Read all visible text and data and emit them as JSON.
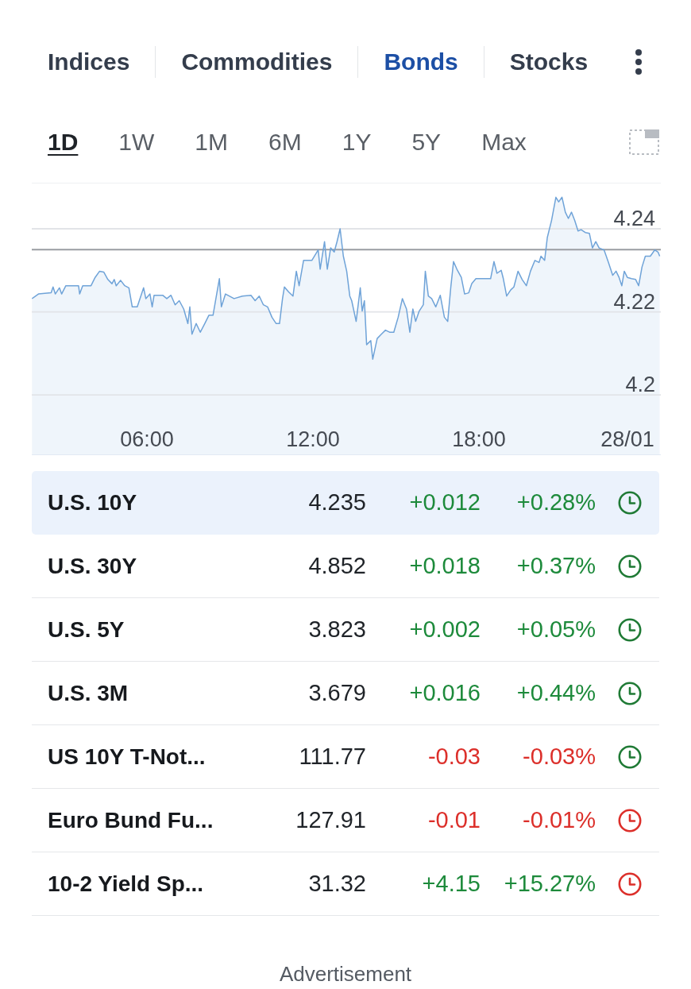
{
  "market_tabs": [
    {
      "label": "Indices",
      "selected": false
    },
    {
      "label": "Commodities",
      "selected": false
    },
    {
      "label": "Bonds",
      "selected": true
    },
    {
      "label": "Stocks",
      "selected": false
    }
  ],
  "time_ranges": [
    {
      "label": "1D",
      "selected": true
    },
    {
      "label": "1W",
      "selected": false
    },
    {
      "label": "1M",
      "selected": false
    },
    {
      "label": "6M",
      "selected": false
    },
    {
      "label": "1Y",
      "selected": false
    },
    {
      "label": "5Y",
      "selected": false
    },
    {
      "label": "Max",
      "selected": false
    }
  ],
  "chart": {
    "chart_data": {
      "type": "area",
      "grid": true,
      "x": [
        1.85,
        2.08,
        2.54,
        2.61,
        2.69,
        2.84,
        2.92,
        3.07,
        3.53,
        3.57,
        3.68,
        3.98,
        4.13,
        4.29,
        4.44,
        4.59,
        4.74,
        4.82,
        4.89,
        5.05,
        5.2,
        5.35,
        5.47,
        5.65,
        5.88,
        5.96,
        6.11,
        6.19,
        6.26,
        6.57,
        6.72,
        6.87,
        7.02,
        7.17,
        7.33,
        7.48,
        7.55,
        7.63,
        7.78,
        7.93,
        8.09,
        8.24,
        8.39,
        8.51,
        8.62,
        8.69,
        8.84,
        9.15,
        9.45,
        9.76,
        9.91,
        10.06,
        10.21,
        10.36,
        10.52,
        10.67,
        10.79,
        10.9,
        10.97,
        11.12,
        11.28,
        11.4,
        11.5,
        11.66,
        11.96,
        12.19,
        12.26,
        12.42,
        12.52,
        12.64,
        12.77,
        12.87,
        12.98,
        13.1,
        13.22,
        13.33,
        13.4,
        13.56,
        13.71,
        13.78,
        13.86,
        13.94,
        14.09,
        14.16,
        14.32,
        14.47,
        14.62,
        14.77,
        14.92,
        15.08,
        15.23,
        15.38,
        15.5,
        15.61,
        15.71,
        15.84,
        15.99,
        16.06,
        16.17,
        16.29,
        16.44,
        16.6,
        16.75,
        16.87,
        16.98,
        17.08,
        17.2,
        17.36,
        17.48,
        17.63,
        17.74,
        17.89,
        18.42,
        18.54,
        18.65,
        18.8,
        18.88,
        19.0,
        19.15,
        19.26,
        19.41,
        19.56,
        19.71,
        19.86,
        20.02,
        20.17,
        20.24,
        20.37,
        20.47,
        20.62,
        20.78,
        20.88,
        21.0,
        21.12,
        21.23,
        21.34,
        21.46,
        21.58,
        21.69,
        21.84,
        21.99,
        22.1,
        22.22,
        22.34,
        22.52,
        22.68,
        22.83,
        22.95,
        23.06,
        23.16,
        23.25,
        23.36,
        23.51,
        23.66,
        23.77,
        23.89,
        24.01,
        24.19,
        24.35,
        24.47,
        24.53
      ],
      "series": [
        {
          "color": "#6fa3d8",
          "values": [
            4.2232,
            4.2243,
            4.2246,
            4.226,
            4.2243,
            4.2258,
            4.2243,
            4.2263,
            4.2263,
            4.2243,
            4.2263,
            4.2263,
            4.2283,
            4.2298,
            4.2296,
            4.2278,
            4.2268,
            4.2278,
            4.2263,
            4.2276,
            4.2263,
            4.2258,
            4.2212,
            4.2212,
            4.2258,
            4.2232,
            4.2243,
            4.2212,
            4.224,
            4.224,
            4.2232,
            4.224,
            4.2217,
            4.2227,
            4.2207,
            4.2172,
            4.2212,
            4.2146,
            4.2172,
            4.2151,
            4.2172,
            4.2192,
            4.2192,
            4.2238,
            4.228,
            4.2212,
            4.2243,
            4.2232,
            4.2238,
            4.224,
            4.2227,
            4.2238,
            4.2217,
            4.2212,
            4.2187,
            4.2172,
            4.2172,
            4.2232,
            4.226,
            4.2248,
            4.2238,
            4.2298,
            4.2263,
            4.2324,
            4.2324,
            4.2349,
            4.2303,
            4.2369,
            4.2303,
            4.2354,
            4.2344,
            4.2369,
            4.24,
            4.2334,
            4.2298,
            4.2238,
            4.2227,
            4.2177,
            4.2258,
            4.2202,
            4.2227,
            4.2121,
            4.2131,
            4.2086,
            4.2136,
            4.2146,
            4.2156,
            4.2151,
            4.2151,
            4.2187,
            4.2232,
            4.2207,
            4.2151,
            4.2207,
            4.2177,
            4.2202,
            4.2217,
            4.2298,
            4.2238,
            4.2232,
            4.2212,
            4.224,
            4.2187,
            4.2177,
            4.2258,
            4.2321,
            4.2303,
            4.2283,
            4.2243,
            4.2246,
            4.2268,
            4.228,
            4.228,
            4.2321,
            4.2293,
            4.23,
            4.228,
            4.2238,
            4.2253,
            4.226,
            4.2298,
            4.2278,
            4.2263,
            4.2298,
            4.2324,
            4.2319,
            4.2334,
            4.2324,
            4.2379,
            4.242,
            4.2476,
            4.2465,
            4.2476,
            4.244,
            4.2425,
            4.244,
            4.242,
            4.2395,
            4.2398,
            4.2391,
            4.2389,
            4.2354,
            4.2369,
            4.2354,
            4.2349,
            4.2319,
            4.2288,
            4.2298,
            4.2283,
            4.2263,
            4.2298,
            4.2283,
            4.228,
            4.2278,
            4.2263,
            4.2308,
            4.2334,
            4.2334,
            4.2349,
            4.2344,
            4.2334
          ]
        }
      ],
      "xlim": [
        1.84,
        24.57
      ],
      "ylim": [
        4.1855,
        4.2511
      ],
      "xticks": [
        {
          "value": 6,
          "label": "06:00"
        },
        {
          "value": 12,
          "label": "12:00"
        },
        {
          "value": 18,
          "label": "18:00"
        },
        {
          "value": 24,
          "label": "28/01"
        }
      ],
      "yticks": [
        4.2,
        4.22,
        4.24
      ],
      "ref_lines": [
        {
          "axis": "y",
          "value": 4.235,
          "color": "#9a9da2"
        }
      ]
    }
  },
  "table": {
    "rows": [
      {
        "name": "U.S. 10Y",
        "last": "4.235",
        "change": "+0.012",
        "change_pct": "+0.28%",
        "rising": true,
        "color": "#1f7a35",
        "selected": true
      },
      {
        "name": "U.S. 30Y",
        "last": "4.852",
        "change": "+0.018",
        "change_pct": "+0.37%",
        "rising": true,
        "color": "#1f7a35",
        "selected": false
      },
      {
        "name": "U.S. 5Y",
        "last": "3.823",
        "change": "+0.002",
        "change_pct": "+0.05%",
        "rising": true,
        "color": "#1f7a35",
        "selected": false
      },
      {
        "name": "U.S. 3M",
        "last": "3.679",
        "change": "+0.016",
        "change_pct": "+0.44%",
        "rising": true,
        "color": "#1f7a35",
        "selected": false
      },
      {
        "name": "US 10Y T-Not...",
        "last": "111.77",
        "change": "-0.03",
        "change_pct": "-0.03%",
        "rising": false,
        "color": "#1f7a35",
        "selected": false
      },
      {
        "name": "Euro Bund Fu...",
        "last": "127.91",
        "change": "-0.01",
        "change_pct": "-0.01%",
        "rising": false,
        "color": "#dc2f2a",
        "selected": false
      },
      {
        "name": "10-2 Yield Sp...",
        "last": "31.32",
        "change": "+4.15",
        "change_pct": "+15.27%",
        "rising": true,
        "color": "#dc2f2a",
        "selected": false
      }
    ]
  },
  "advertisement": {
    "label": "Advertisement"
  }
}
